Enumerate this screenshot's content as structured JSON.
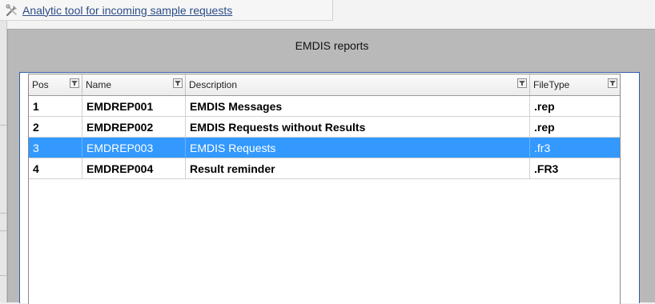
{
  "window": {
    "tab_title": "Analytic tool for incoming sample requests",
    "tab_icon": "tools-icon"
  },
  "dialog": {
    "title": "EMDIS reports",
    "colors": {
      "dialog_bg": "#b9b9b9",
      "selection": "#3399ff",
      "frame_border": "#2f5ea8"
    }
  },
  "grid": {
    "columns": [
      {
        "key": "pos",
        "label": "Pos"
      },
      {
        "key": "name",
        "label": "Name"
      },
      {
        "key": "description",
        "label": "Description"
      },
      {
        "key": "filetype",
        "label": "FileType"
      }
    ],
    "rows": [
      {
        "pos": "1",
        "name": "EMDREP001",
        "description": "EMDIS Messages",
        "filetype": ".rep",
        "selected": false
      },
      {
        "pos": "2",
        "name": "EMDREP002",
        "description": "EMDIS Requests without Results",
        "filetype": ".rep",
        "selected": false
      },
      {
        "pos": "3",
        "name": "EMDREP003",
        "description": "EMDIS Requests",
        "filetype": ".fr3",
        "selected": true
      },
      {
        "pos": "4",
        "name": "EMDREP004",
        "description": "Result reminder",
        "filetype": ".FR3",
        "selected": false
      }
    ]
  }
}
